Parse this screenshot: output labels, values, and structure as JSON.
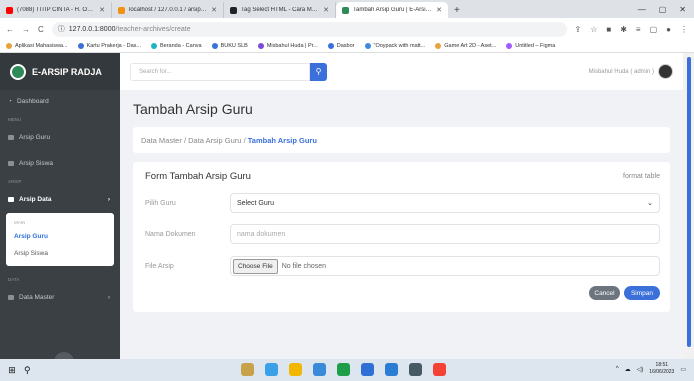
{
  "browser": {
    "tabs": [
      {
        "title": "(7088) TITIP CINTA - H. ONA SU",
        "color": "#ff0000",
        "active": false
      },
      {
        "title": "localhost / 127.0.0.1 / arsip_app",
        "color": "#f29111",
        "active": false
      },
      {
        "title": "Tag Select HTML - Cara Membu",
        "color": "#1e2327",
        "active": false
      },
      {
        "title": "Tambah Arsip Guru | E-Arsip Rad",
        "color": "#2e8b57",
        "active": true
      }
    ],
    "new_tab": "+",
    "url_host": "127.0.0.1:8000",
    "url_path": "/teacher-archives/create",
    "bookmarks": [
      {
        "label": "Aplikasi Mahasiswa...",
        "color": "#e8a33d"
      },
      {
        "label": "Kartu Prakerja - Das...",
        "color": "#3b6fd9"
      },
      {
        "label": "Beranda - Canva",
        "color": "#1fb3c4"
      },
      {
        "label": "BUKU SLB",
        "color": "#3b6fd9"
      },
      {
        "label": "Misbahul Huda | Pr...",
        "color": "#7b4bd6"
      },
      {
        "label": "Dasbor",
        "color": "#3b6fd9"
      },
      {
        "label": "\"Ooypack with matt...",
        "color": "#3d8be0"
      },
      {
        "label": "Game Art 2D - Aset...",
        "color": "#e8a33d"
      },
      {
        "label": "Untitled – Figma",
        "color": "#a259ff"
      }
    ]
  },
  "app": {
    "brand": "E-ARSIP RADJA",
    "search_placeholder": "Search for...",
    "user_label": "Misbahul Huda ( admin )"
  },
  "sidebar": {
    "dashboard": "Dashboard",
    "head_menu": "MENU",
    "arsip_guru": "Arsip Guru",
    "arsip_siswa": "Arsip Siswa",
    "head_arsip": "ARSIP",
    "arsip_data": "Arsip Data",
    "submenu_head": "MAIN",
    "sub_arsip_guru": "Arsip Guru",
    "sub_arsip_siswa": "Arsip Siswa",
    "head_data": "DATA",
    "data_master": "Data Master"
  },
  "page": {
    "title": "Tambah Arsip Guru",
    "breadcrumb": [
      "Data Master",
      "Data Arsip Guru",
      "Tambah Arsip Guru"
    ],
    "card_title": "Form Tambah Arsip Guru",
    "card_link": "format table",
    "label_guru": "Pilih Guru",
    "select_value": "Select Guru",
    "label_nama": "Nama Dokumen",
    "nama_placeholder": "nama dokumen",
    "label_file": "File Arsip",
    "file_button": "Choose File",
    "file_status": "No file chosen",
    "cancel": "Cancel",
    "save": "Simpan"
  },
  "taskbar": {
    "apps": [
      "#c8a14b",
      "#3aa0e8",
      "#f2b705",
      "#3b8ad9",
      "#1f9e4a",
      "#2f6fd6",
      "#2b7cd3",
      "#455a64",
      "#f44336"
    ],
    "time": "18:51",
    "date": "16/06/2023"
  }
}
